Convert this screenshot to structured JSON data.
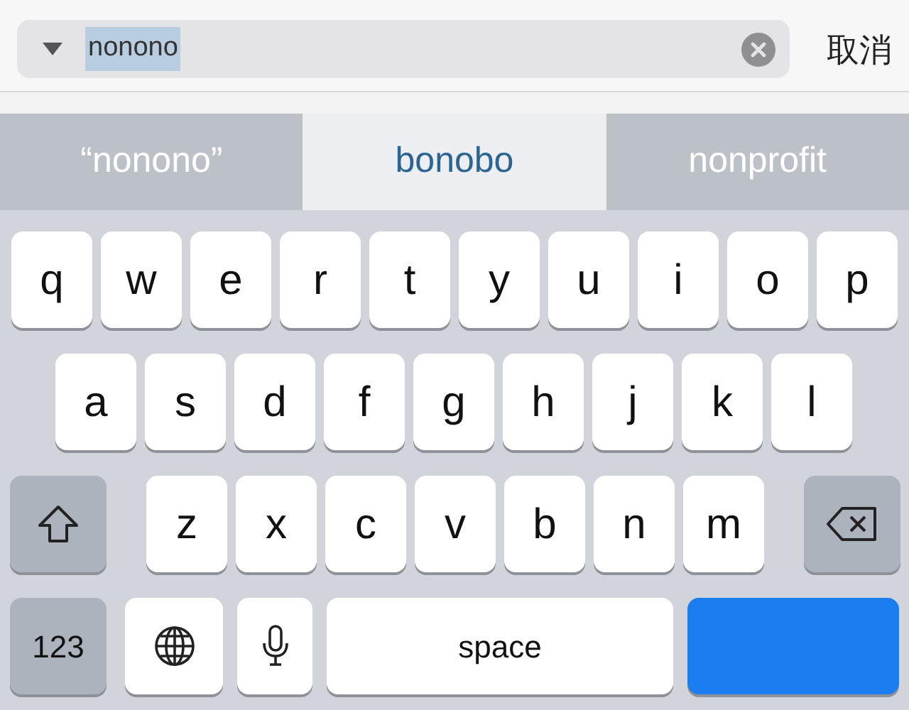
{
  "search": {
    "value": "nonono",
    "value_selected": true,
    "cancel": "取消"
  },
  "suggestions": [
    {
      "label": "“nonono”",
      "selected": false
    },
    {
      "label": "bonobo",
      "selected": true
    },
    {
      "label": "nonprofit",
      "selected": false
    }
  ],
  "keyboard": {
    "rows": [
      [
        {
          "kind": "letter",
          "label": "q"
        },
        {
          "kind": "letter",
          "label": "w"
        },
        {
          "kind": "letter",
          "label": "e"
        },
        {
          "kind": "letter",
          "label": "r"
        },
        {
          "kind": "letter",
          "label": "t"
        },
        {
          "kind": "letter",
          "label": "y"
        },
        {
          "kind": "letter",
          "label": "u"
        },
        {
          "kind": "letter",
          "label": "i"
        },
        {
          "kind": "letter",
          "label": "o"
        },
        {
          "kind": "letter",
          "label": "p"
        }
      ],
      [
        {
          "kind": "letter",
          "label": "a"
        },
        {
          "kind": "letter",
          "label": "s"
        },
        {
          "kind": "letter",
          "label": "d"
        },
        {
          "kind": "letter",
          "label": "f"
        },
        {
          "kind": "letter",
          "label": "g"
        },
        {
          "kind": "letter",
          "label": "h"
        },
        {
          "kind": "letter",
          "label": "j"
        },
        {
          "kind": "letter",
          "label": "k"
        },
        {
          "kind": "letter",
          "label": "l"
        }
      ],
      [
        {
          "kind": "shift"
        },
        {
          "kind": "letter",
          "label": "z"
        },
        {
          "kind": "letter",
          "label": "x"
        },
        {
          "kind": "letter",
          "label": "c"
        },
        {
          "kind": "letter",
          "label": "v"
        },
        {
          "kind": "letter",
          "label": "b"
        },
        {
          "kind": "letter",
          "label": "n"
        },
        {
          "kind": "letter",
          "label": "m"
        },
        {
          "kind": "delete"
        }
      ],
      [
        {
          "kind": "mode",
          "label": "123"
        },
        {
          "kind": "globe"
        },
        {
          "kind": "mic"
        },
        {
          "kind": "space",
          "label": "space"
        },
        {
          "kind": "return"
        }
      ]
    ]
  }
}
